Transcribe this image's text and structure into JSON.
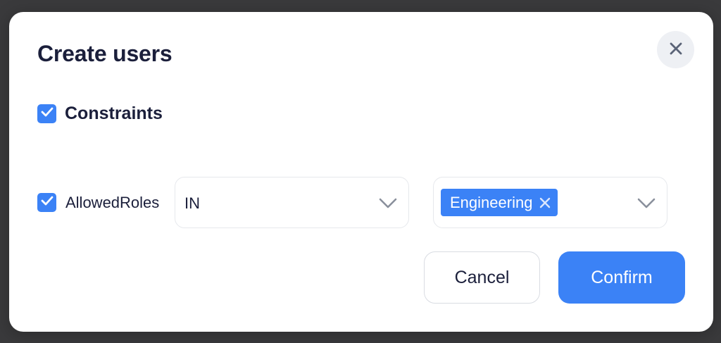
{
  "modal": {
    "title": "Create users",
    "close_icon": "close-icon"
  },
  "constraints": {
    "checked": true,
    "label": "Constraints"
  },
  "rule": {
    "checked": true,
    "field_label": "AllowedRoles",
    "operator": {
      "selected": "IN",
      "icon": "chevron-down-icon"
    },
    "values": {
      "tags": [
        "Engineering"
      ],
      "icon": "chevron-down-icon"
    }
  },
  "actions": {
    "cancel_label": "Cancel",
    "confirm_label": "Confirm"
  },
  "colors": {
    "accent": "#3b82f6",
    "text": "#1b1f3b"
  }
}
